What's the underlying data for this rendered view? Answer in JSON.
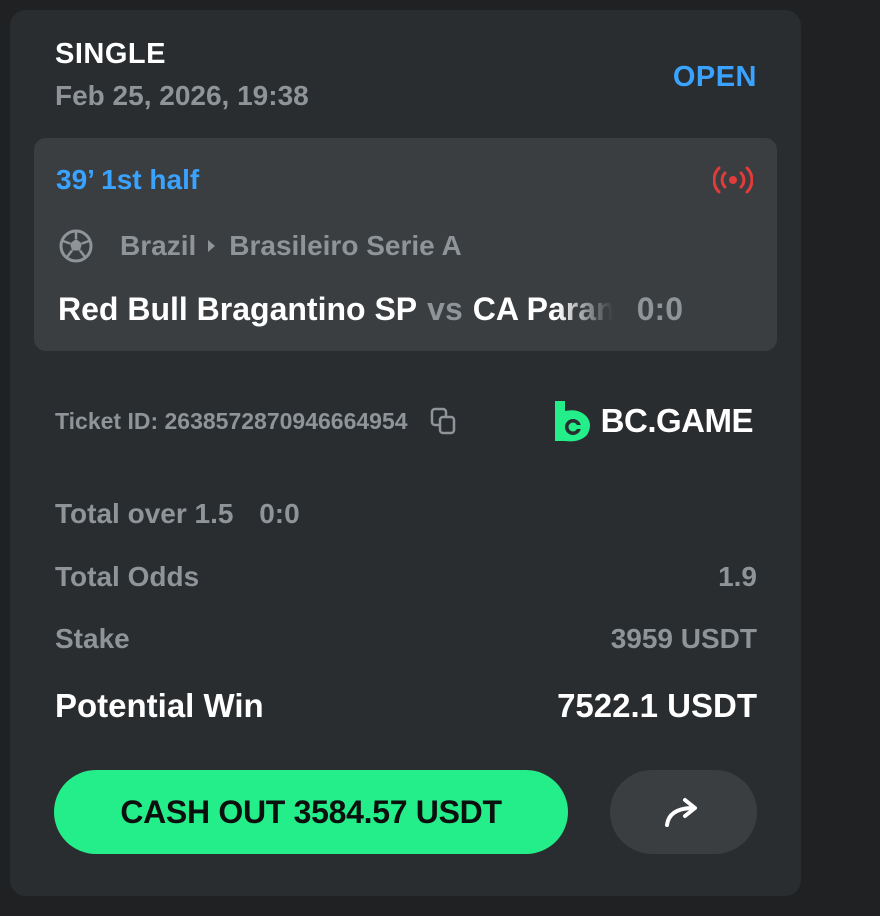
{
  "bet": {
    "type": "SINGLE",
    "date": "Feb 25, 2026, 19:38",
    "status": "OPEN",
    "status_color": "#3aa2ff"
  },
  "match": {
    "live_time": "39’ 1st half",
    "live_icon": "live-broadcast-icon",
    "sport_icon": "soccer-ball-icon",
    "country": "Brazil",
    "league": "Brasileiro Serie A",
    "home_team": "Red Bull Bragantino SP",
    "vs": "vs",
    "away_team": "CA Paranaense",
    "score": "0:0"
  },
  "ticket": {
    "label": "Ticket ID: 2638572870946664954",
    "copy_icon": "copy-icon"
  },
  "brand": {
    "name": "BC.GAME",
    "color": "#24ee89"
  },
  "details": {
    "selection": "Total over 1.5",
    "selection_score": "0:0",
    "odds_label": "Total Odds",
    "odds_value": "1.9",
    "stake_label": "Stake",
    "stake_value": "3959 USDT",
    "win_label": "Potential Win",
    "win_value": "7522.1 USDT"
  },
  "actions": {
    "cashout_label": "CASH OUT 3584.57 USDT",
    "cashout_color": "#24ee89",
    "share_icon": "share-arrow-icon"
  }
}
